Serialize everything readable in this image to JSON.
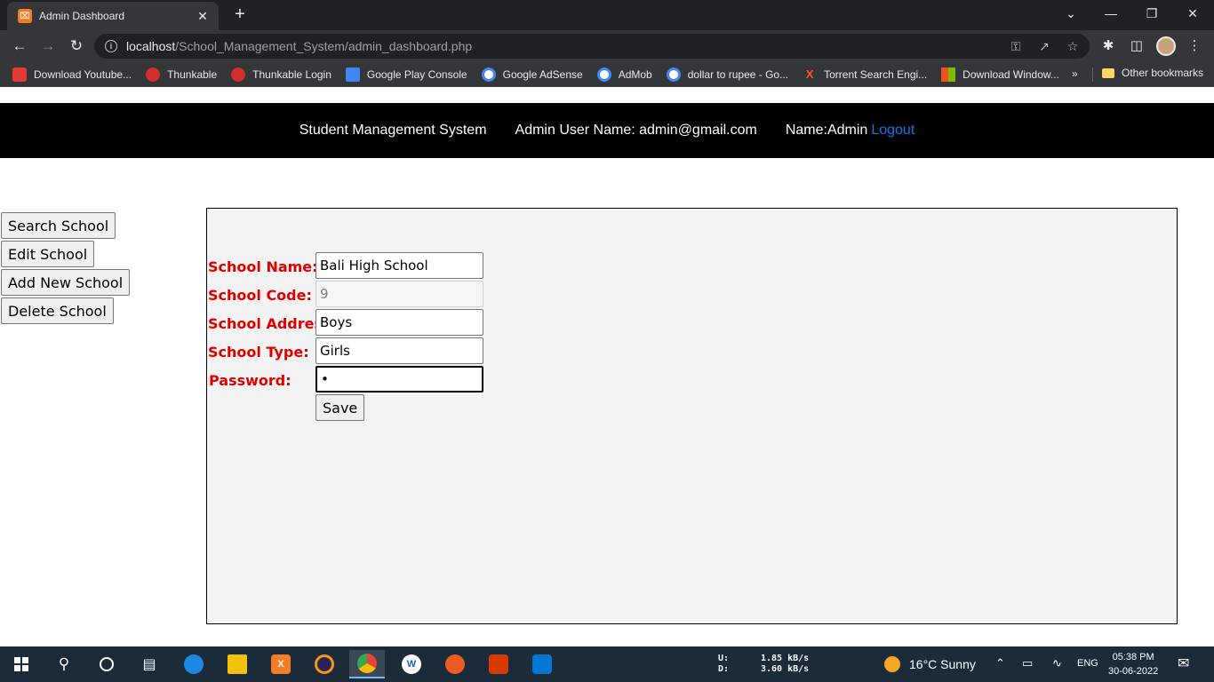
{
  "browser": {
    "tab_title": "Admin Dashboard",
    "url_host": "localhost",
    "url_path": "/School_Management_System/admin_dashboard.php",
    "bookmarks": [
      {
        "label": "Download Youtube...",
        "color": "#e53935"
      },
      {
        "label": "Thunkable",
        "color": "#d32f2f"
      },
      {
        "label": "Thunkable Login",
        "color": "#d32f2f"
      },
      {
        "label": "Google Play Console",
        "color": "#4285f4"
      },
      {
        "label": "Google AdSense",
        "color": "#ffffff"
      },
      {
        "label": "AdMob",
        "color": "#ffffff"
      },
      {
        "label": "dollar to rupee - Go...",
        "color": "#ffffff"
      },
      {
        "label": "Torrent Search Engi...",
        "color": "#ff5722"
      },
      {
        "label": "Download Window...",
        "color": "#4caf50"
      }
    ],
    "bookmarks_more": "»",
    "other_bookmarks": "Other bookmarks"
  },
  "header": {
    "brand": "Student Management System",
    "admin_user": "Admin User Name: admin@gmail.com",
    "name": "Name:Admin",
    "logout": "Logout"
  },
  "sidebar": {
    "search": "Search School",
    "edit": "Edit School",
    "add": "Add New School",
    "delete": "Delete School"
  },
  "form": {
    "name_label": "School Name:",
    "name_value": "Bali High School",
    "code_label": "School Code:",
    "code_value": "9",
    "address_label": "School Address:",
    "address_value": "Boys",
    "type_label": "School Type:",
    "type_value": "Girls",
    "password_label": "Password:",
    "password_value": "•",
    "save": "Save"
  },
  "taskbar": {
    "net_labels": "U:\nD:",
    "upload": "1.85 kB/s",
    "download": "3.60 kB/s",
    "weather": "16°C  Sunny",
    "lang": "ENG",
    "time": "05:38 PM",
    "date": "30-06-2022"
  }
}
